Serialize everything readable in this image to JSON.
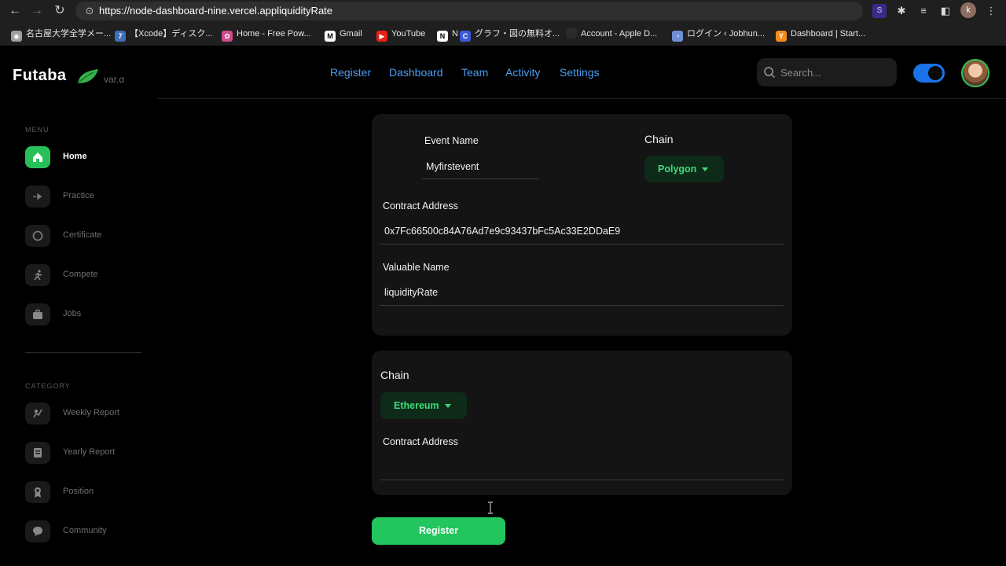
{
  "browser": {
    "url": "https://node-dashboard-nine.vercel.appliquidityRate",
    "profile_initial": "k",
    "bookmarks": [
      {
        "label": "名古屋大学全学メー...",
        "color": "#9e9e9e",
        "glyph": "◉"
      },
      {
        "label": "【Xcode】ディスク...",
        "color": "#3f6fb5",
        "glyph": "7"
      },
      {
        "label": "Home - Free Pow...",
        "color": "#d04c8c",
        "glyph": "✿"
      },
      {
        "label": "Gmail",
        "color": "#ffffff",
        "glyph": "M"
      },
      {
        "label": "YouTube",
        "color": "#e62117",
        "glyph": "▶"
      },
      {
        "label": "N",
        "color": "#ffffff",
        "glyph": "N"
      },
      {
        "label": "グラフ・図の無料オ...",
        "color": "#3a5bd9",
        "glyph": "C"
      },
      {
        "label": "Account - Apple D...",
        "color": "#2a2a2a",
        "glyph": ""
      },
      {
        "label": "ログイン ‹ Jobhun...",
        "color": "#6d8fd6",
        "glyph": "◔"
      },
      {
        "label": "Dashboard | Start...",
        "color": "#f28c1c",
        "glyph": "Y"
      }
    ]
  },
  "app": {
    "logo": "Futaba",
    "version": "var.α",
    "nav": [
      "Register",
      "Dashboard",
      "Team",
      "Activity",
      "Settings"
    ],
    "search_placeholder": "Search...",
    "sidebar": {
      "menu_title": "MENU",
      "menu": [
        {
          "label": "Home",
          "icon": "home-icon",
          "active": true
        },
        {
          "label": "Practice",
          "icon": "arrow-right-icon",
          "active": false
        },
        {
          "label": "Certificate",
          "icon": "badge-icon",
          "active": false
        },
        {
          "label": "Compete",
          "icon": "runner-icon",
          "active": false
        },
        {
          "label": "Jobs",
          "icon": "briefcase-icon",
          "active": false
        }
      ],
      "category_title": "CATEGORY",
      "category": [
        {
          "label": "Weekly Report",
          "icon": "chart-icon"
        },
        {
          "label": "Yearly Report",
          "icon": "book-icon"
        },
        {
          "label": "Position",
          "icon": "award-icon"
        },
        {
          "label": "Community",
          "icon": "chat-icon"
        }
      ]
    },
    "form1": {
      "event_name_label": "Event Name",
      "event_name_value": "Myfirstevent",
      "chain_label": "Chain",
      "chain_value": "Polygon",
      "contract_label": "Contract Address",
      "contract_value": "0x7Fc66500c84A76Ad7e9c93437bFc5Ac33E2DDaE9",
      "valuable_label": "Valuable Name",
      "valuable_value": "liquidityRate"
    },
    "form2": {
      "chain_label": "Chain",
      "chain_value": "Ethereum",
      "contract_label": "Contract Address",
      "contract_value": ""
    },
    "register_button": "Register"
  },
  "colors": {
    "accent_green": "#23c55e",
    "link_blue": "#4a9df0",
    "toggle_blue": "#1a73e8"
  }
}
